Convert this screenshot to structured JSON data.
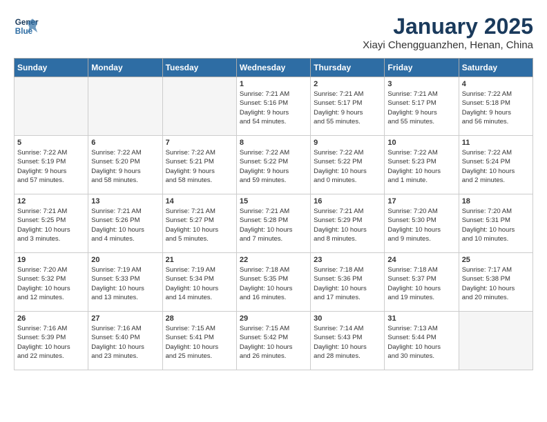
{
  "header": {
    "logo_line1": "General",
    "logo_line2": "Blue",
    "title": "January 2025",
    "subtitle": "Xiayi Chengguanzhen, Henan, China"
  },
  "weekdays": [
    "Sunday",
    "Monday",
    "Tuesday",
    "Wednesday",
    "Thursday",
    "Friday",
    "Saturday"
  ],
  "weeks": [
    [
      {
        "day": "",
        "info": ""
      },
      {
        "day": "",
        "info": ""
      },
      {
        "day": "",
        "info": ""
      },
      {
        "day": "1",
        "info": "Sunrise: 7:21 AM\nSunset: 5:16 PM\nDaylight: 9 hours\nand 54 minutes."
      },
      {
        "day": "2",
        "info": "Sunrise: 7:21 AM\nSunset: 5:17 PM\nDaylight: 9 hours\nand 55 minutes."
      },
      {
        "day": "3",
        "info": "Sunrise: 7:21 AM\nSunset: 5:17 PM\nDaylight: 9 hours\nand 55 minutes."
      },
      {
        "day": "4",
        "info": "Sunrise: 7:22 AM\nSunset: 5:18 PM\nDaylight: 9 hours\nand 56 minutes."
      }
    ],
    [
      {
        "day": "5",
        "info": "Sunrise: 7:22 AM\nSunset: 5:19 PM\nDaylight: 9 hours\nand 57 minutes."
      },
      {
        "day": "6",
        "info": "Sunrise: 7:22 AM\nSunset: 5:20 PM\nDaylight: 9 hours\nand 58 minutes."
      },
      {
        "day": "7",
        "info": "Sunrise: 7:22 AM\nSunset: 5:21 PM\nDaylight: 9 hours\nand 58 minutes."
      },
      {
        "day": "8",
        "info": "Sunrise: 7:22 AM\nSunset: 5:22 PM\nDaylight: 9 hours\nand 59 minutes."
      },
      {
        "day": "9",
        "info": "Sunrise: 7:22 AM\nSunset: 5:22 PM\nDaylight: 10 hours\nand 0 minutes."
      },
      {
        "day": "10",
        "info": "Sunrise: 7:22 AM\nSunset: 5:23 PM\nDaylight: 10 hours\nand 1 minute."
      },
      {
        "day": "11",
        "info": "Sunrise: 7:22 AM\nSunset: 5:24 PM\nDaylight: 10 hours\nand 2 minutes."
      }
    ],
    [
      {
        "day": "12",
        "info": "Sunrise: 7:21 AM\nSunset: 5:25 PM\nDaylight: 10 hours\nand 3 minutes."
      },
      {
        "day": "13",
        "info": "Sunrise: 7:21 AM\nSunset: 5:26 PM\nDaylight: 10 hours\nand 4 minutes."
      },
      {
        "day": "14",
        "info": "Sunrise: 7:21 AM\nSunset: 5:27 PM\nDaylight: 10 hours\nand 5 minutes."
      },
      {
        "day": "15",
        "info": "Sunrise: 7:21 AM\nSunset: 5:28 PM\nDaylight: 10 hours\nand 7 minutes."
      },
      {
        "day": "16",
        "info": "Sunrise: 7:21 AM\nSunset: 5:29 PM\nDaylight: 10 hours\nand 8 minutes."
      },
      {
        "day": "17",
        "info": "Sunrise: 7:20 AM\nSunset: 5:30 PM\nDaylight: 10 hours\nand 9 minutes."
      },
      {
        "day": "18",
        "info": "Sunrise: 7:20 AM\nSunset: 5:31 PM\nDaylight: 10 hours\nand 10 minutes."
      }
    ],
    [
      {
        "day": "19",
        "info": "Sunrise: 7:20 AM\nSunset: 5:32 PM\nDaylight: 10 hours\nand 12 minutes."
      },
      {
        "day": "20",
        "info": "Sunrise: 7:19 AM\nSunset: 5:33 PM\nDaylight: 10 hours\nand 13 minutes."
      },
      {
        "day": "21",
        "info": "Sunrise: 7:19 AM\nSunset: 5:34 PM\nDaylight: 10 hours\nand 14 minutes."
      },
      {
        "day": "22",
        "info": "Sunrise: 7:18 AM\nSunset: 5:35 PM\nDaylight: 10 hours\nand 16 minutes."
      },
      {
        "day": "23",
        "info": "Sunrise: 7:18 AM\nSunset: 5:36 PM\nDaylight: 10 hours\nand 17 minutes."
      },
      {
        "day": "24",
        "info": "Sunrise: 7:18 AM\nSunset: 5:37 PM\nDaylight: 10 hours\nand 19 minutes."
      },
      {
        "day": "25",
        "info": "Sunrise: 7:17 AM\nSunset: 5:38 PM\nDaylight: 10 hours\nand 20 minutes."
      }
    ],
    [
      {
        "day": "26",
        "info": "Sunrise: 7:16 AM\nSunset: 5:39 PM\nDaylight: 10 hours\nand 22 minutes."
      },
      {
        "day": "27",
        "info": "Sunrise: 7:16 AM\nSunset: 5:40 PM\nDaylight: 10 hours\nand 23 minutes."
      },
      {
        "day": "28",
        "info": "Sunrise: 7:15 AM\nSunset: 5:41 PM\nDaylight: 10 hours\nand 25 minutes."
      },
      {
        "day": "29",
        "info": "Sunrise: 7:15 AM\nSunset: 5:42 PM\nDaylight: 10 hours\nand 26 minutes."
      },
      {
        "day": "30",
        "info": "Sunrise: 7:14 AM\nSunset: 5:43 PM\nDaylight: 10 hours\nand 28 minutes."
      },
      {
        "day": "31",
        "info": "Sunrise: 7:13 AM\nSunset: 5:44 PM\nDaylight: 10 hours\nand 30 minutes."
      },
      {
        "day": "",
        "info": ""
      }
    ]
  ]
}
